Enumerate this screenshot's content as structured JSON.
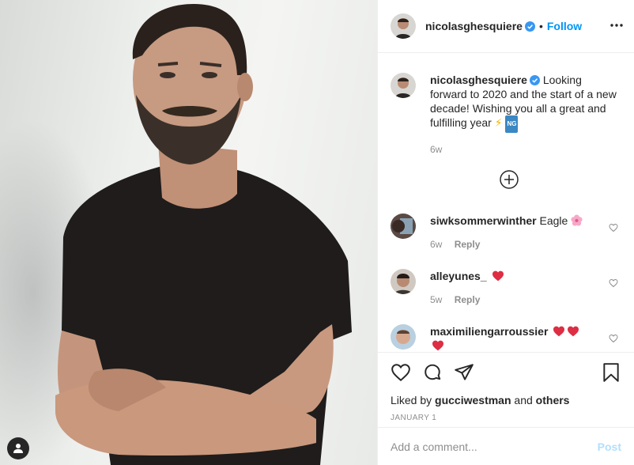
{
  "post": {
    "author": "nicolasghesquiere",
    "follow_label": "Follow",
    "dot": "•",
    "photo_alt": "Portrait of a man with a beard in a black t-shirt, arms crossed"
  },
  "caption": {
    "username": "nicolasghesquiere",
    "text": "Looking forward to 2020 and the start of a new decade! Wishing you all a great and fulfilling year",
    "emoji_bolt": "⚡",
    "emoji_ng": "NG",
    "time": "6w"
  },
  "comments": [
    {
      "username": "siwksommerwinther",
      "text": "Eagle",
      "time": "6w",
      "reply": "Reply",
      "avatar": "avatar-siwk"
    },
    {
      "username": "alleyunes_",
      "text": "",
      "time": "5w",
      "reply": "Reply",
      "avatar": "avatar-alleyunes"
    },
    {
      "username": "maximiliengarroussier",
      "text": "",
      "time": "",
      "reply": "",
      "avatar": "avatar-maximilien"
    }
  ],
  "likes": {
    "prefix": "Liked by",
    "user": "gucciwestman",
    "and": "and",
    "others": "others"
  },
  "date": "JANUARY 1",
  "add_comment": {
    "placeholder": "Add a comment...",
    "post_label": "Post"
  },
  "colors": {
    "link": "#0095f6",
    "verified": "#3897f0",
    "heart": "#ed4956",
    "muted": "#8e8e8e",
    "post_disabled": "#b2dffc"
  }
}
